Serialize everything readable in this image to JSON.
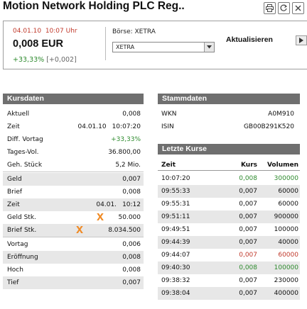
{
  "title": "Motion Network Holding PLC Reg..",
  "toolbar": {
    "icons": [
      "print-icon",
      "refresh-icon",
      "close-icon"
    ]
  },
  "quote": {
    "date": "04.01.10",
    "time": "10:07 Uhr",
    "price": "0,008 EUR",
    "change_pct": "+33,33%",
    "change_abs": "[+0,002]",
    "boerse_label": "Börse: XETRA",
    "boerse_selected": "XETRA",
    "aktualisieren": "Aktualisieren",
    "colors": {
      "date": "#c0392b",
      "change": "#2e8b2e"
    }
  },
  "kursdaten": {
    "heading": "Kursdaten",
    "rows": [
      {
        "label": "Aktuell",
        "mid": "",
        "value": "0,008"
      },
      {
        "label": "Zeit",
        "mid": "04.01.10",
        "value": "10:07:20"
      },
      {
        "label": "Diff. Vortag",
        "mid": "",
        "value": "+33,33%"
      },
      {
        "label": "Tages-Vol.",
        "mid": "",
        "value": "36.800,00"
      },
      {
        "label": "Geh. Stück",
        "mid": "",
        "value": "5,2 Mio."
      },
      {
        "label": "Geld",
        "mid": "",
        "value": "0,007"
      },
      {
        "label": "Brief",
        "mid": "",
        "value": "0,008"
      },
      {
        "label": "Zeit",
        "mid": "04.01.",
        "value": "10:12"
      },
      {
        "label": "Geld Stk.",
        "mid": "",
        "value": "50.000"
      },
      {
        "label": "Brief Stk.",
        "mid": "",
        "value": "8.034.500"
      },
      {
        "label": "Vortag",
        "mid": "",
        "value": "0,006"
      },
      {
        "label": "Eröffnung",
        "mid": "",
        "value": "0,008"
      },
      {
        "label": "Hoch",
        "mid": "",
        "value": "0,008"
      },
      {
        "label": "Tief",
        "mid": "",
        "value": "0,007"
      }
    ]
  },
  "stammdaten": {
    "heading": "Stammdaten",
    "rows": [
      {
        "label": "WKN",
        "value": "A0M910"
      },
      {
        "label": "ISIN",
        "value": "GB00B291K520"
      }
    ]
  },
  "letzte_kurse": {
    "heading": "Letzte Kurse",
    "columns": [
      "Zeit",
      "Kurs",
      "Volumen"
    ],
    "rows": [
      {
        "zeit": "10:07:20",
        "kurs": "0,008",
        "volumen": "300000",
        "color": "green"
      },
      {
        "zeit": "09:55:33",
        "kurs": "0,007",
        "volumen": "60000",
        "color": "black"
      },
      {
        "zeit": "09:55:31",
        "kurs": "0,007",
        "volumen": "60000",
        "color": "black"
      },
      {
        "zeit": "09:51:11",
        "kurs": "0,007",
        "volumen": "900000",
        "color": "black"
      },
      {
        "zeit": "09:49:51",
        "kurs": "0,007",
        "volumen": "100000",
        "color": "black"
      },
      {
        "zeit": "09:44:39",
        "kurs": "0,007",
        "volumen": "40000",
        "color": "black"
      },
      {
        "zeit": "09:44:07",
        "kurs": "0,007",
        "volumen": "60000",
        "color": "red"
      },
      {
        "zeit": "09:40:30",
        "kurs": "0,008",
        "volumen": "100000",
        "color": "green"
      },
      {
        "zeit": "09:38:32",
        "kurs": "0,007",
        "volumen": "230000",
        "color": "black"
      },
      {
        "zeit": "09:38:04",
        "kurs": "0,007",
        "volumen": "400000",
        "color": "black"
      }
    ]
  },
  "annotations": {
    "marks": [
      "x",
      "x"
    ],
    "color": "#f08a24"
  }
}
